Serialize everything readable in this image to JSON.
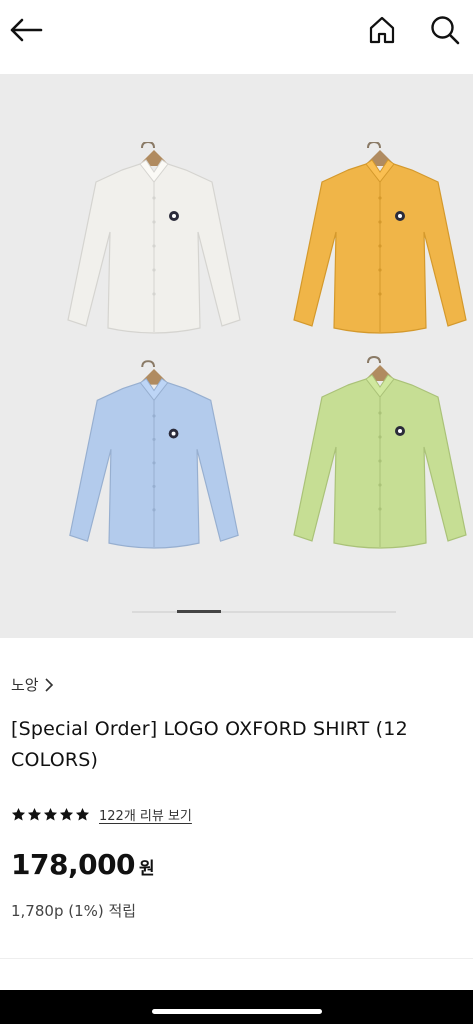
{
  "header": {
    "back_icon": "arrow-left-icon",
    "home_icon": "home-icon",
    "search_icon": "search-icon"
  },
  "gallery": {
    "shirts": [
      {
        "name": "white",
        "color": "#f1f0ec"
      },
      {
        "name": "yellow",
        "color": "#f0b548"
      },
      {
        "name": "blue",
        "color": "#b3cbec"
      },
      {
        "name": "green",
        "color": "#c6de94"
      }
    ],
    "current_slide_fraction": 0.17
  },
  "product": {
    "brand": "노앙",
    "title": "[Special Order] LOGO OXFORD SHIRT (12 COLORS)",
    "rating_stars": 5,
    "review_link": "122개 리뷰 보기",
    "price": "178,000",
    "price_unit": "원",
    "points": "1,780p (1%) 적립"
  }
}
